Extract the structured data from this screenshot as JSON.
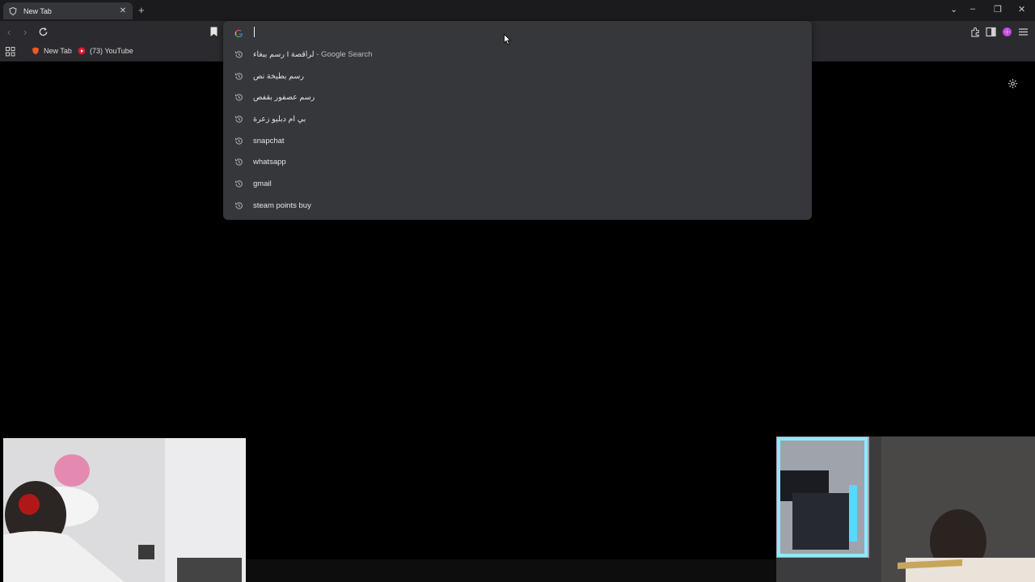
{
  "tab": {
    "title": "New Tab",
    "close_glyph": "✕",
    "favicon": "brave-shield-icon"
  },
  "tabstrip": {
    "new_tab_glyph": "+",
    "window_controls": [
      "⌄",
      "–",
      "❐",
      "✕"
    ]
  },
  "toolbar": {
    "back": "‹",
    "forward": "›"
  },
  "bookmarks": [
    {
      "label": "New Tab",
      "icon": "brave-lion-icon"
    },
    {
      "label": "(73) YouTube",
      "icon": "youtube-icon"
    }
  ],
  "omnibox": {
    "value": "",
    "suggestions": [
      {
        "text": "رسم ببغاء I لراقصة",
        "suffix": " - Google Search"
      },
      {
        "text": "رسم بطيخة نص",
        "suffix": ""
      },
      {
        "text": "رسم عصفور بقفص",
        "suffix": ""
      },
      {
        "text": "بي ام دبليو زعرة",
        "suffix": ""
      },
      {
        "text": "snapchat",
        "suffix": ""
      },
      {
        "text": "whatsapp",
        "suffix": ""
      },
      {
        "text": "gmail",
        "suffix": ""
      },
      {
        "text": "steam points buy",
        "suffix": ""
      }
    ]
  },
  "colors": {
    "accent_purple": "#b64de0",
    "youtube_red": "#e0182d",
    "brave_orange": "#f05a24"
  }
}
